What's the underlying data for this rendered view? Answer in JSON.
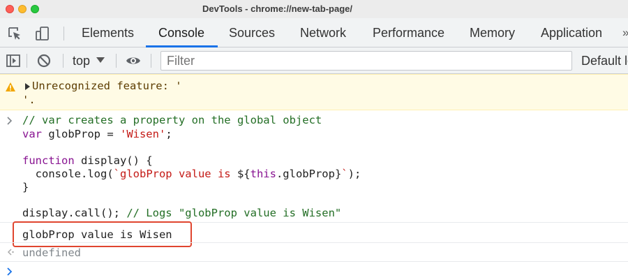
{
  "window": {
    "title": "DevTools - chrome://new-tab-page/"
  },
  "tabs": [
    {
      "label": "Elements"
    },
    {
      "label": "Console"
    },
    {
      "label": "Sources"
    },
    {
      "label": "Network"
    },
    {
      "label": "Performance"
    },
    {
      "label": "Memory"
    },
    {
      "label": "Application"
    }
  ],
  "tabs_more": "»",
  "active_tab": "Console",
  "toolbar": {
    "context": "top",
    "filter_placeholder": "Filter",
    "levels_label": "Default le"
  },
  "console": {
    "warning_line1": "Unrecognized feature: '",
    "warning_line2": "'.",
    "code": {
      "line1_comment": "// var creates a property on the global object",
      "line2_kw": "var",
      "line2_rest": " globProp = ",
      "line2_str": "'Wisen'",
      "line2_end": ";",
      "line4_kw": "function",
      "line4_rest": " display() {",
      "line5_a": "  console.log(",
      "line5_str1": "`globProp value is ",
      "line5_interp_open": "${",
      "line5_this": "this",
      "line5_prop": ".globProp}",
      "line5_str2": "`",
      "line5_end": ");",
      "line6": "}",
      "line8_a": "display.call(); ",
      "line8_comment": "// Logs \"globProp value is Wisen\""
    },
    "log_output": "globProp value is Wisen",
    "return_value": "undefined"
  },
  "colors": {
    "accent": "#1a73e8",
    "highlight_border": "#e0452f",
    "warning_bg": "#fffbe5"
  }
}
